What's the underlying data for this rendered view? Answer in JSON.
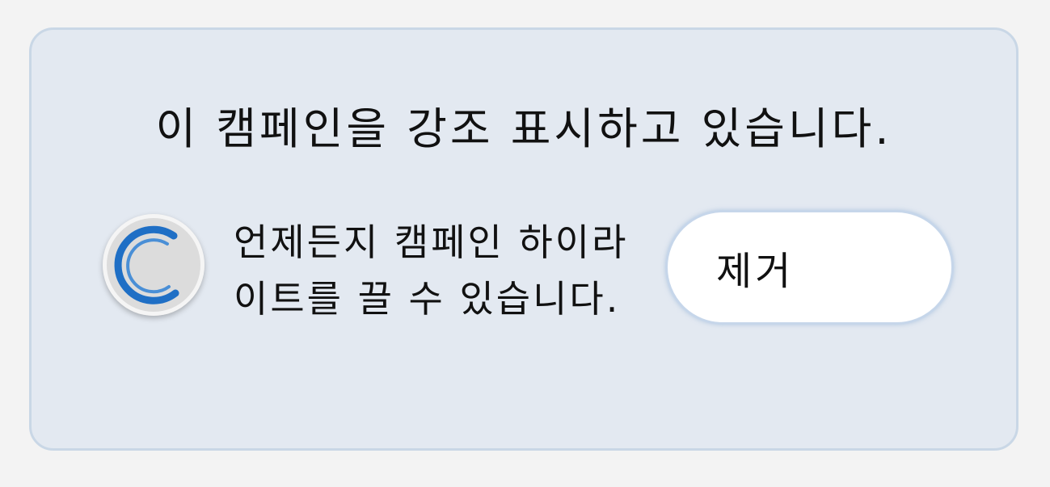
{
  "notice": {
    "headline": "이 캠페인을 강조 표시하고 있습니다.",
    "message": "언제든지 캠페인 하이라이트를 끌 수 있습니다.",
    "remove_button_label": "제거",
    "icon": "spinner-icon"
  },
  "colors": {
    "card_background": "#e3e9f1",
    "card_border": "#c9d7e6",
    "accent": "#1f6fc5",
    "button_background": "#ffffff"
  }
}
